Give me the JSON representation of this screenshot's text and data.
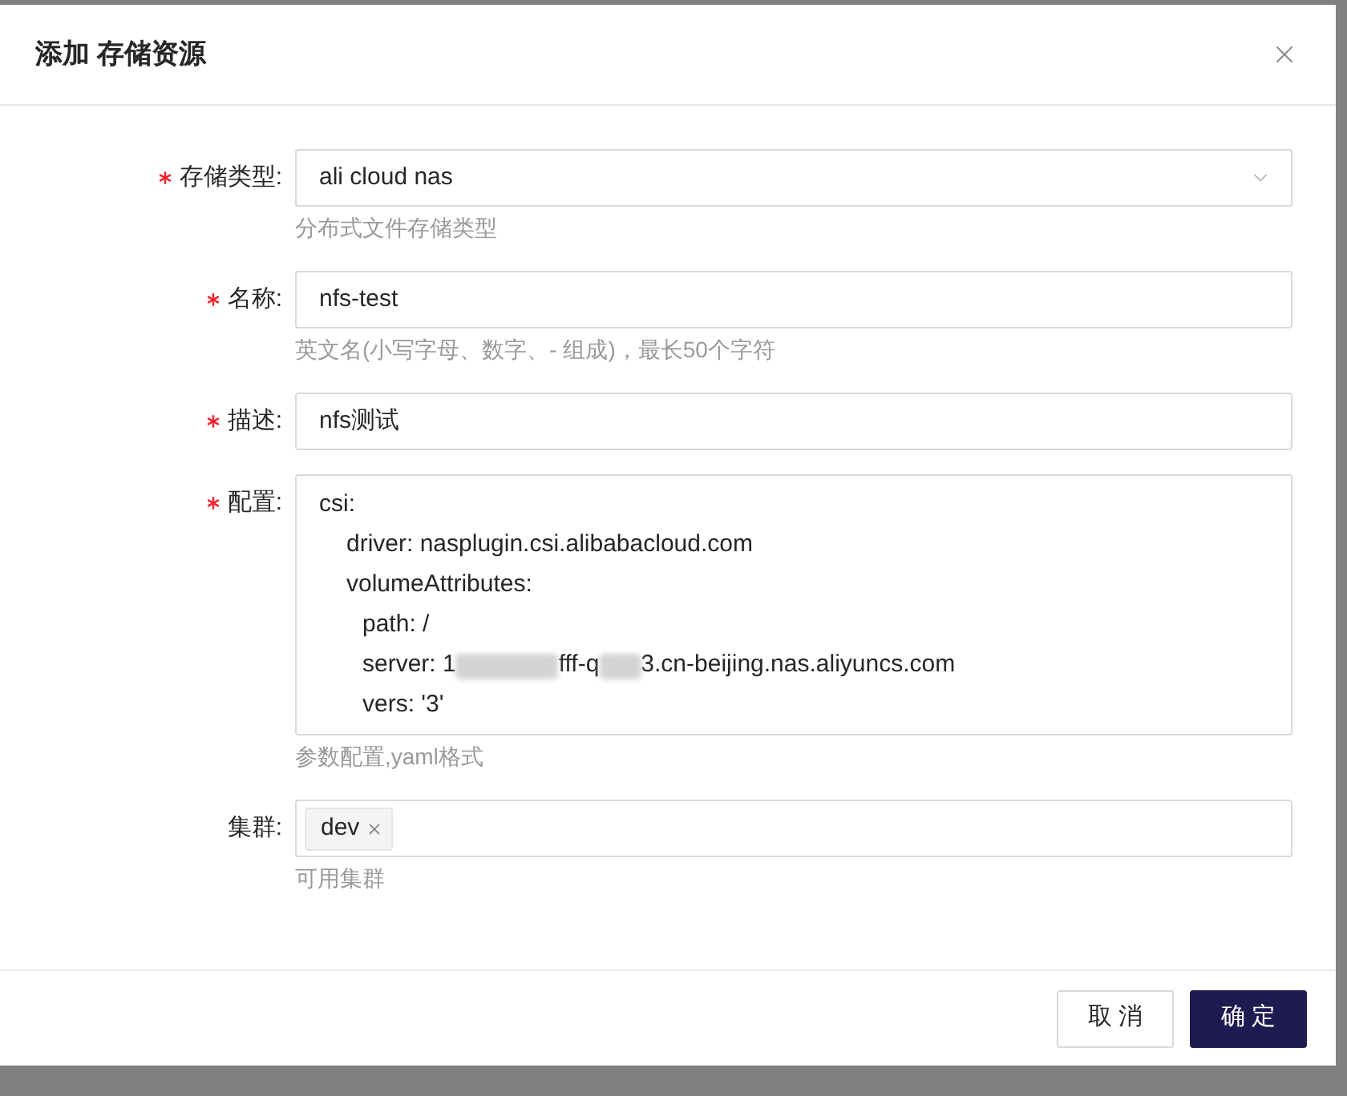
{
  "dialog": {
    "title": "添加 存储资源"
  },
  "fields": [
    {
      "kind": "select",
      "label": "存储类型:",
      "required": true,
      "value": "ali cloud nas",
      "help": "分布式文件存储类型"
    },
    {
      "kind": "text",
      "label": "名称:",
      "required": true,
      "value": "nfs-test",
      "help": "英文名(小写字母、数字、- 组成)，最长50个字符"
    },
    {
      "kind": "text",
      "label": "描述:",
      "required": true,
      "value": "nfs测试"
    },
    {
      "kind": "textarea",
      "label": "配置:",
      "required": true,
      "lines": [
        {
          "segments": [
            {
              "kind": "text",
              "text": "csi:"
            }
          ],
          "children": [
            {
              "segments": [
                {
                  "kind": "text",
                  "text": "driver: nasplugin.csi.alibabacloud.com"
                }
              ]
            },
            {
              "segments": [
                {
                  "kind": "text",
                  "text": "volumeAttributes:"
                }
              ],
              "children": [
                {
                  "segments": [
                    {
                      "kind": "text",
                      "text": "path: /"
                    }
                  ]
                },
                {
                  "segments": [
                    {
                      "kind": "text",
                      "text": "server: 1"
                    },
                    {
                      "kind": "redacted"
                    },
                    {
                      "kind": "text",
                      "text": "fff-q"
                    },
                    {
                      "kind": "redacted"
                    },
                    {
                      "kind": "text",
                      "text": "3.cn-beijing.nas.aliyuncs.com"
                    }
                  ]
                },
                {
                  "segments": [
                    {
                      "kind": "text",
                      "text": "vers: '3'"
                    }
                  ]
                }
              ]
            }
          ]
        }
      ],
      "help": "参数配置,yaml格式"
    },
    {
      "kind": "tags",
      "label": "集群:",
      "required": false,
      "tags": [
        "dev"
      ],
      "help": "可用集群"
    }
  ],
  "buttons": [
    {
      "label": "取 消",
      "kind": "default"
    },
    {
      "label": "确 定",
      "kind": "primary"
    }
  ]
}
